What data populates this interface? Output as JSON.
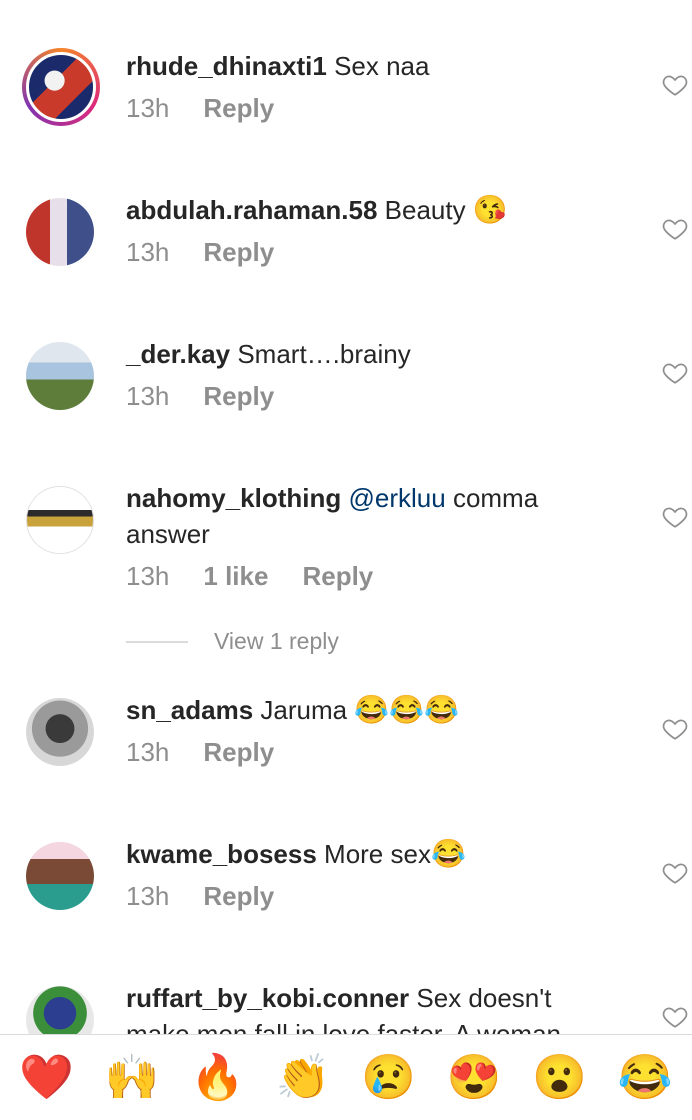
{
  "comments": [
    {
      "username": "rhude_dhinaxti1",
      "text": "Sex naa",
      "emoji": "",
      "time": "13h",
      "likes": "",
      "reply": "Reply",
      "avatar_colors": [
        "#1b2a6b",
        "#c93a2b",
        "#f2f2f2"
      ]
    },
    {
      "username": "abdulah.rahaman.58",
      "text": "Beauty",
      "emoji": "😘",
      "time": "13h",
      "likes": "",
      "reply": "Reply",
      "avatar_colors": [
        "#c0352b",
        "#e7e0ea",
        "#3f4f8a"
      ]
    },
    {
      "username": "_der.kay",
      "text": "Smart….brainy",
      "emoji": "",
      "time": "13h",
      "likes": "",
      "reply": "Reply",
      "avatar_colors": [
        "#a9c4de",
        "#5f7d3a",
        "#dfe6ee"
      ]
    },
    {
      "username": "nahomy_klothing",
      "mention": "@erkluu",
      "text": "comma answer",
      "emoji": "",
      "time": "13h",
      "likes": "1 like",
      "reply": "Reply",
      "avatar_colors": [
        "#ffffff",
        "#2b2b2b",
        "#c8a23a"
      ]
    },
    {
      "username": "sn_adams",
      "text": "Jaruma",
      "emoji": "😂😂😂",
      "time": "13h",
      "likes": "",
      "reply": "Reply",
      "avatar_colors": [
        "#3a3a3a",
        "#9a9a9a",
        "#d7d7d7"
      ]
    },
    {
      "username": "kwame_bosess",
      "text": "More sex",
      "emoji": "😂",
      "time": "13h",
      "likes": "",
      "reply": "Reply",
      "avatar_colors": [
        "#7a4a36",
        "#2a9d8f",
        "#f3d6e0"
      ]
    },
    {
      "username": "ruffart_by_kobi.conner",
      "text": "Sex doesn't make men fall in love faster. A woman",
      "emoji": "",
      "time": "",
      "likes": "",
      "reply": "",
      "avatar_colors": [
        "#2c3e8f",
        "#3b8f3a",
        "#e8e8e8"
      ]
    }
  ],
  "view_replies": "View 1 reply",
  "reactions": [
    {
      "glyph": "❤️",
      "name": "red-heart"
    },
    {
      "glyph": "🙌",
      "name": "raised-hands"
    },
    {
      "glyph": "🔥",
      "name": "fire"
    },
    {
      "glyph": "👏",
      "name": "clapping-hands"
    },
    {
      "glyph": "😢",
      "name": "sad-face"
    },
    {
      "glyph": "😍",
      "name": "heart-eyes"
    },
    {
      "glyph": "😮",
      "name": "surprised-face"
    },
    {
      "glyph": "😂",
      "name": "tears-of-joy"
    }
  ],
  "colors": {
    "text": "#262626",
    "meta": "#8e8e8e",
    "mention": "#00376b",
    "divider": "#dbdbdb"
  }
}
